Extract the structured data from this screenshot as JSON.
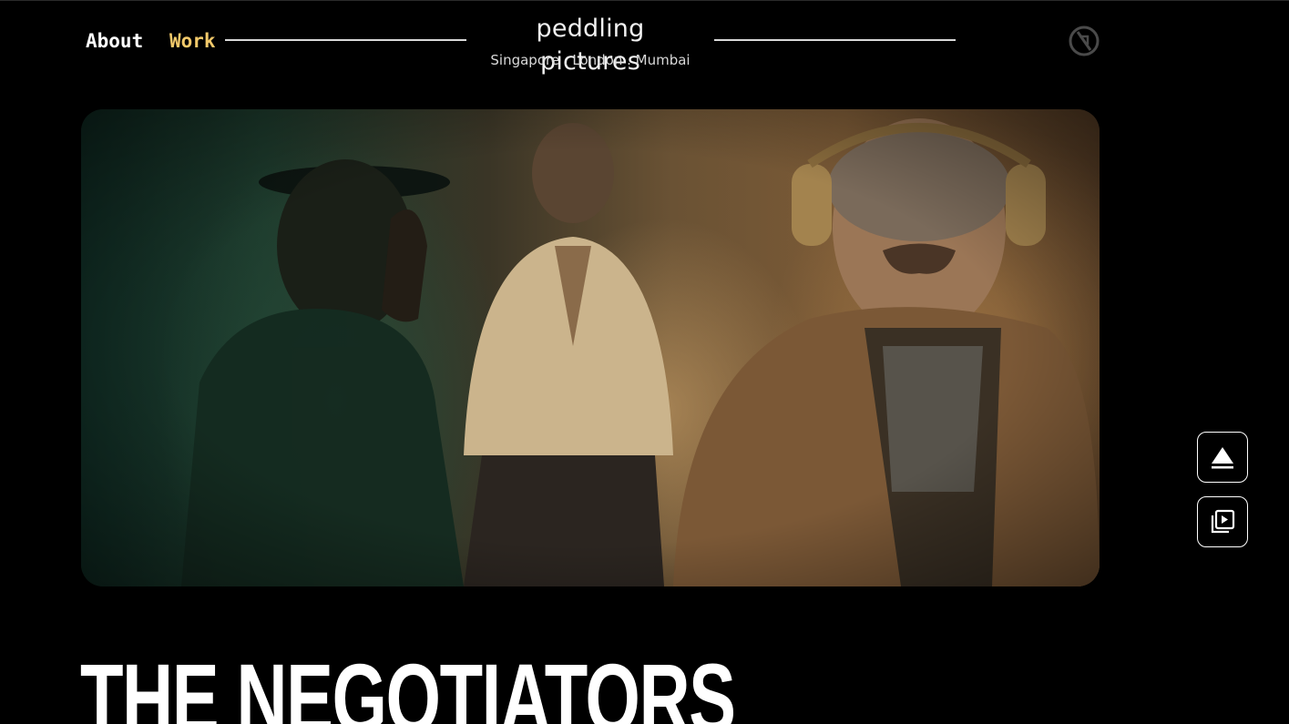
{
  "nav": {
    "about_label": "About",
    "work_label": "Work",
    "active_color": "#f2c96a"
  },
  "brand": {
    "title": "peddling pictures",
    "locations": "Singapore . London . Mumbai"
  },
  "icons": {
    "theme_toggle": "crossed-circle-icon",
    "scroll_up": "eject-up-icon",
    "video_library": "video-library-icon"
  },
  "hero": {
    "image": "film-still"
  },
  "project": {
    "title": "THE NEGOTIATORS"
  }
}
